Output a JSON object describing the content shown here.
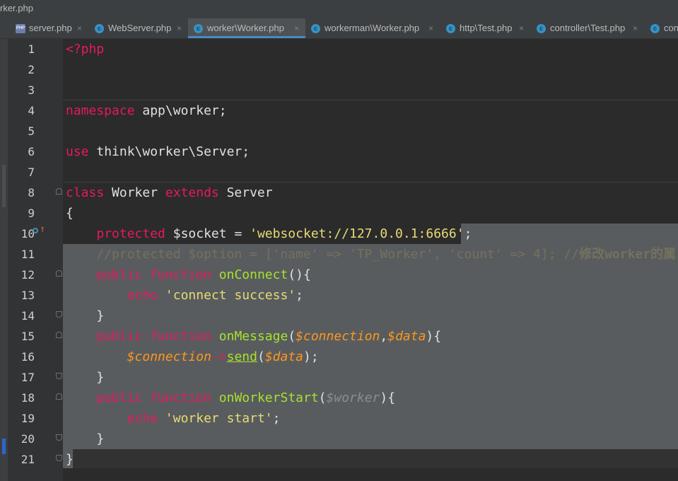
{
  "window": {
    "title": "rker.php"
  },
  "tabs": [
    {
      "label": "server.php",
      "icon": "php-file-icon",
      "icon_text": "PHP",
      "close": "×",
      "active": false
    },
    {
      "label": "WebServer.php",
      "icon": "class-c-icon",
      "icon_text": "c",
      "close": "×",
      "active": false
    },
    {
      "label": "worker\\Worker.php",
      "icon": "class-c-icon",
      "icon_text": "c",
      "close": "×",
      "active": true
    },
    {
      "label": "workerman\\Worker.php",
      "icon": "class-c-icon",
      "icon_text": "c",
      "close": "×",
      "active": false
    },
    {
      "label": "http\\Test.php",
      "icon": "class-c-icon",
      "icon_text": "c",
      "close": "×",
      "active": false
    },
    {
      "label": "controller\\Test.php",
      "icon": "class-c-icon",
      "icon_text": "c",
      "close": "×",
      "active": false
    },
    {
      "label": "con",
      "icon": "class-c-icon",
      "icon_text": "c",
      "close": "",
      "active": false
    }
  ],
  "gutter": {
    "line_numbers": [
      "1",
      "2",
      "3",
      "4",
      "5",
      "6",
      "7",
      "8",
      "9",
      "10",
      "11",
      "12",
      "13",
      "14",
      "15",
      "16",
      "17",
      "18",
      "19",
      "20",
      "21"
    ],
    "override_marker_icon": "override-up-arrow-icon",
    "override_arrow": "↑"
  },
  "code": {
    "l1": {
      "t1": "<?php"
    },
    "l4": {
      "t1": "namespace",
      "t2": " app\\worker;"
    },
    "l6": {
      "t1": "use",
      "t2": " think\\worker\\Server;"
    },
    "l8": {
      "t1": "class",
      "t2": " Worker ",
      "t3": "extends",
      "t4": " Server"
    },
    "l9": {
      "t1": "{"
    },
    "l10": {
      "t1": "    ",
      "t2": "protected",
      "t3": " $socket = ",
      "t4": "'websocket://127.0.0.1:6666",
      "t5": "'",
      "t6": ";"
    },
    "l11": {
      "t1": "    //protected $option = ['name' => 'TP_Worker', 'count' => 4]; //",
      "t2": "修改worker的属"
    },
    "l12": {
      "t1": "    ",
      "t2": "public",
      "t3": " ",
      "t4": "function",
      "t5": " ",
      "t6": "onConnect",
      "t7": "(){"
    },
    "l13": {
      "t1": "        ",
      "t2": "echo",
      "t3": " ",
      "t4": "'connect success'",
      "t5": ";"
    },
    "l14": {
      "t1": "    }"
    },
    "l15": {
      "t1": "    ",
      "t2": "public",
      "t3": " ",
      "t4": "function",
      "t5": " ",
      "t6": "onMessage",
      "t7": "(",
      "t8": "$connection",
      "t9": ",",
      "t10": "$data",
      "t11": "){"
    },
    "l16": {
      "t1": "        ",
      "t2": "$connection",
      "t3": "->",
      "t4": "send",
      "t5": "(",
      "t6": "$data",
      "t7": ");"
    },
    "l17": {
      "t1": "    }"
    },
    "l18": {
      "t1": "    ",
      "t2": "public",
      "t3": " ",
      "t4": "function",
      "t5": " ",
      "t6": "onWorkerStart",
      "t7": "(",
      "t8": "$worker",
      "t9": "){"
    },
    "l19": {
      "t1": "        ",
      "t2": "echo",
      "t3": " ",
      "t4": "'worker start'",
      "t5": ";"
    },
    "l20": {
      "t1": "    }"
    },
    "l21": {
      "t1": "}"
    }
  },
  "colors": {
    "keyword": "#e6195f",
    "function": "#a6e22e",
    "string": "#e6db74",
    "variable": "#fd971f",
    "comment": "#75715e",
    "selection": "#595c5e",
    "background": "#2b2b2b"
  }
}
